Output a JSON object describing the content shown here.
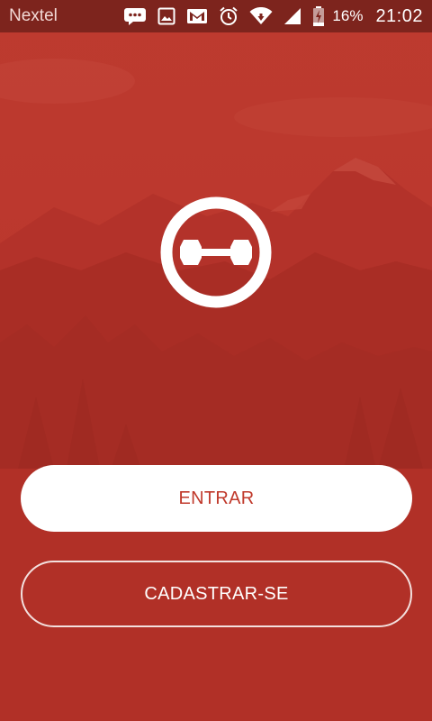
{
  "status_bar": {
    "carrier": "Nextel",
    "battery_percent": "16%",
    "time": "21:02",
    "icons": [
      "message-icon",
      "image-icon",
      "gmail-icon",
      "alarm-icon",
      "wifi-icon",
      "signal-icon",
      "battery-charging-icon"
    ]
  },
  "logo": {
    "icon": "dumbbell-icon"
  },
  "buttons": {
    "login_label": "ENTRAR",
    "signup_label": "CADASTRAR-SE"
  },
  "colors": {
    "primary": "#c0392b",
    "background": "#b9332a",
    "status_bar": "#7d241d",
    "white": "#ffffff"
  }
}
